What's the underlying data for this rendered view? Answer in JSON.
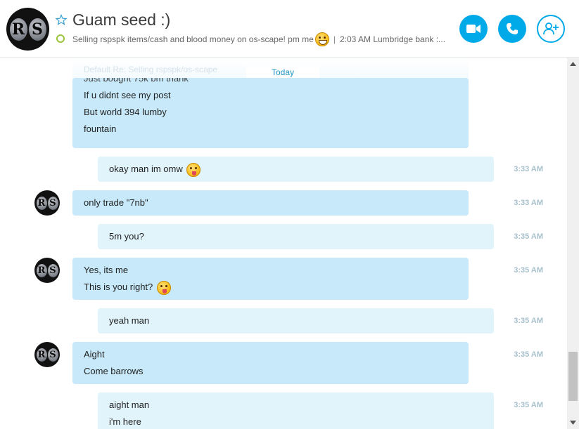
{
  "header": {
    "title": "Guam seed :)",
    "mood_main": "Selling rspspk items/cash and blood money on os-scape!  pm me",
    "mood_sep": "|",
    "mood_trail": "2:03 AM Lumbridge bank :...",
    "avatar_letters": [
      "R",
      "S"
    ],
    "icons": {
      "favorite": "star-icon",
      "video": "video-camera-icon",
      "call": "phone-icon",
      "add": "add-person-icon"
    },
    "accent_color": "#00a9e7",
    "status_color": "#9ac43c"
  },
  "chat": {
    "today_label": "Today",
    "faded_preview": "Default Re: Selling rspspk/os-scape",
    "first_block": [
      "Just bought 75k bm thank",
      "If u didnt see my post",
      "But world 394 lumby",
      "fountain"
    ],
    "messages": [
      {
        "dir": "out",
        "lines": [
          "okay man im omw"
        ],
        "emoji": "tongue",
        "time": "3:33 AM"
      },
      {
        "dir": "in",
        "lines": [
          "only trade \"7nb\""
        ],
        "time": "3:33 AM"
      },
      {
        "dir": "out",
        "lines": [
          "5m you?"
        ],
        "time": "3:35 AM"
      },
      {
        "dir": "in",
        "lines": [
          "Yes, its me",
          "This is you right?"
        ],
        "emoji": "tongue",
        "time": "3:35 AM"
      },
      {
        "dir": "out",
        "lines": [
          "yeah man"
        ],
        "time": "3:35 AM"
      },
      {
        "dir": "in",
        "lines": [
          "Aight",
          "Come barrows"
        ],
        "time": "3:35 AM"
      },
      {
        "dir": "out",
        "lines": [
          "aight man",
          "i'm here"
        ],
        "time": "3:35 AM"
      }
    ],
    "incoming_bubble_color": "#c7e9f9",
    "outgoing_bubble_color": "#e1f4fc"
  }
}
